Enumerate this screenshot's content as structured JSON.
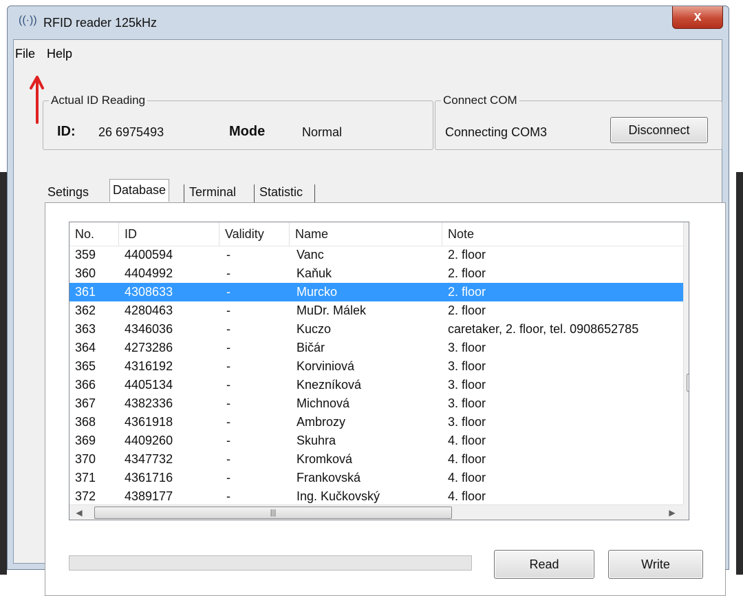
{
  "window": {
    "title": "RFID reader 125kHz",
    "icon": "rfid-reader-icon",
    "close_label": "x"
  },
  "menu": {
    "file": "File",
    "help": "Help"
  },
  "reading": {
    "group_label": "Actual ID Reading",
    "id_label": "ID:",
    "id_value": "26 6975493",
    "mode_label": "Mode",
    "mode_value": "Normal"
  },
  "com": {
    "group_label": "Connect COM",
    "status": "Connecting COM3",
    "disconnect_label": "Disconnect"
  },
  "tabs": [
    {
      "label": "Setings"
    },
    {
      "label": "Database",
      "active": true
    },
    {
      "label": "Terminal"
    },
    {
      "label": "Statistic"
    }
  ],
  "table": {
    "columns": [
      "No.",
      "ID",
      "Validity",
      "Name",
      "Note"
    ],
    "rows": [
      [
        "359",
        "4400594",
        "-",
        "Vanc",
        "2. floor"
      ],
      [
        "360",
        "4404992",
        "-",
        "Kaňuk",
        "2. floor"
      ],
      [
        "361",
        "4308633",
        "-",
        "Murcko",
        "2. floor"
      ],
      [
        "362",
        "4280463",
        "-",
        "MuDr. Málek",
        "2. floor"
      ],
      [
        "363",
        "4346036",
        "-",
        "Kuczo",
        "caretaker, 2. floor, tel. 0908652785"
      ],
      [
        "364",
        "4273286",
        "-",
        "Bičár",
        "3. floor"
      ],
      [
        "365",
        "4316192",
        "-",
        "Korviniová",
        "3. floor"
      ],
      [
        "366",
        "4405134",
        "-",
        "Knezníková",
        "3. floor"
      ],
      [
        "367",
        "4382336",
        "-",
        "Michnová",
        "3. floor"
      ],
      [
        "368",
        "4361918",
        "-",
        "Ambrozy",
        "3. floor"
      ],
      [
        "369",
        "4409260",
        "-",
        "Skuhra",
        "4. floor"
      ],
      [
        "370",
        "4347732",
        "-",
        "Kromková",
        "4. floor"
      ],
      [
        "371",
        "4361716",
        "-",
        "Frankovská",
        "4. floor"
      ],
      [
        "372",
        "4389177",
        "-",
        "Ing. Kučkovský",
        "4. floor"
      ]
    ],
    "selected_row": 2
  },
  "actions": {
    "read_label": "Read",
    "write_label": "Write"
  },
  "colors": {
    "selection": "#3399ff",
    "close_button": "#c74a34",
    "annotation_arrow": "#e02020"
  }
}
